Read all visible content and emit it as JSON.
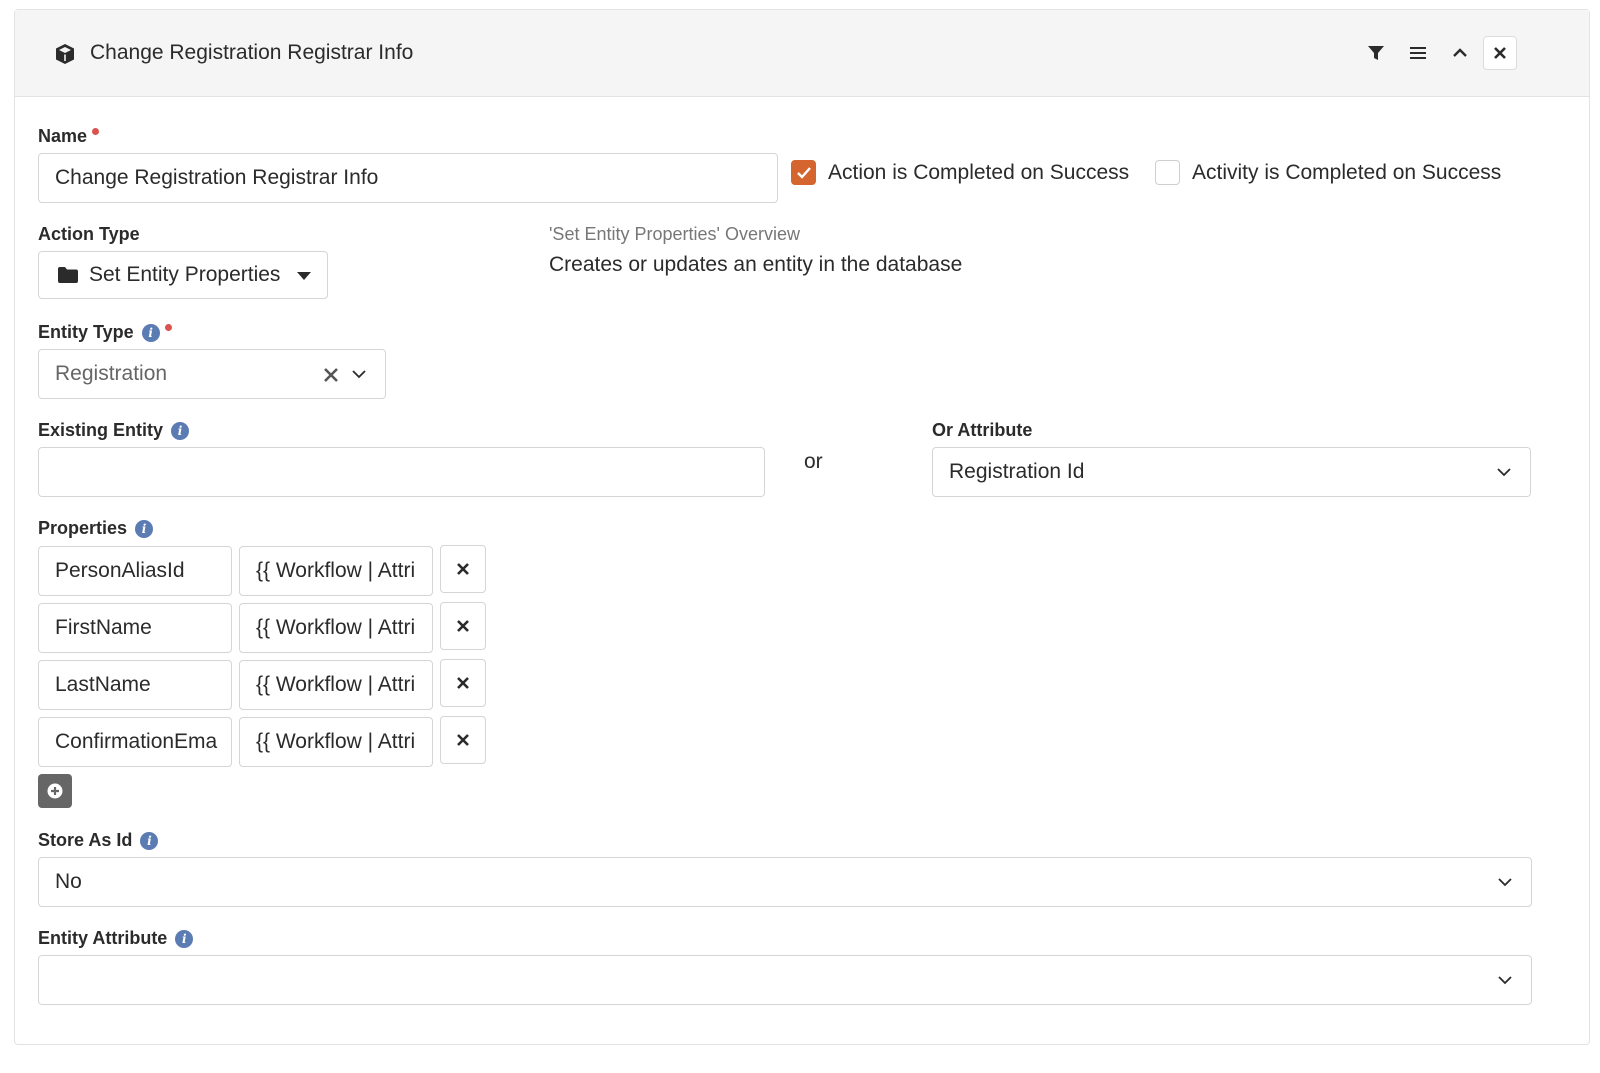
{
  "header": {
    "title": "Change Registration Registrar Info",
    "icons": [
      "cube-icon",
      "filter-icon",
      "menu-icon",
      "chevron-up-icon",
      "close-icon"
    ]
  },
  "name_field": {
    "label": "Name",
    "value": "Change Registration Registrar Info",
    "required": true
  },
  "checkboxes": {
    "action_completed": {
      "label": "Action is Completed on Success",
      "checked": true
    },
    "activity_completed": {
      "label": "Activity is Completed on Success",
      "checked": false
    }
  },
  "action_type": {
    "label": "Action Type",
    "value": "Set Entity Properties",
    "icon": "folder-icon",
    "overview_title": "'Set Entity Properties' Overview",
    "overview_text": "Creates or updates an entity in the database"
  },
  "entity_type": {
    "label": "Entity Type",
    "value": "Registration",
    "required": true
  },
  "existing_entity": {
    "label": "Existing Entity",
    "value": "",
    "or_text": "or"
  },
  "or_attribute": {
    "label": "Or Attribute",
    "value": "Registration Id"
  },
  "properties": {
    "label": "Properties",
    "rows": [
      {
        "key": "PersonAliasId",
        "value": "{{ Workflow | Attri"
      },
      {
        "key": "FirstName",
        "value": "{{ Workflow | Attri"
      },
      {
        "key": "LastName",
        "value": "{{ Workflow | Attri"
      },
      {
        "key": "ConfirmationEma",
        "value": "{{ Workflow | Attri"
      }
    ]
  },
  "store_as_id": {
    "label": "Store As Id",
    "value": "No"
  },
  "entity_attribute": {
    "label": "Entity Attribute",
    "value": ""
  },
  "colors": {
    "accent": "#d4652f",
    "info": "#5b7bb3",
    "required": "#d9534f"
  }
}
